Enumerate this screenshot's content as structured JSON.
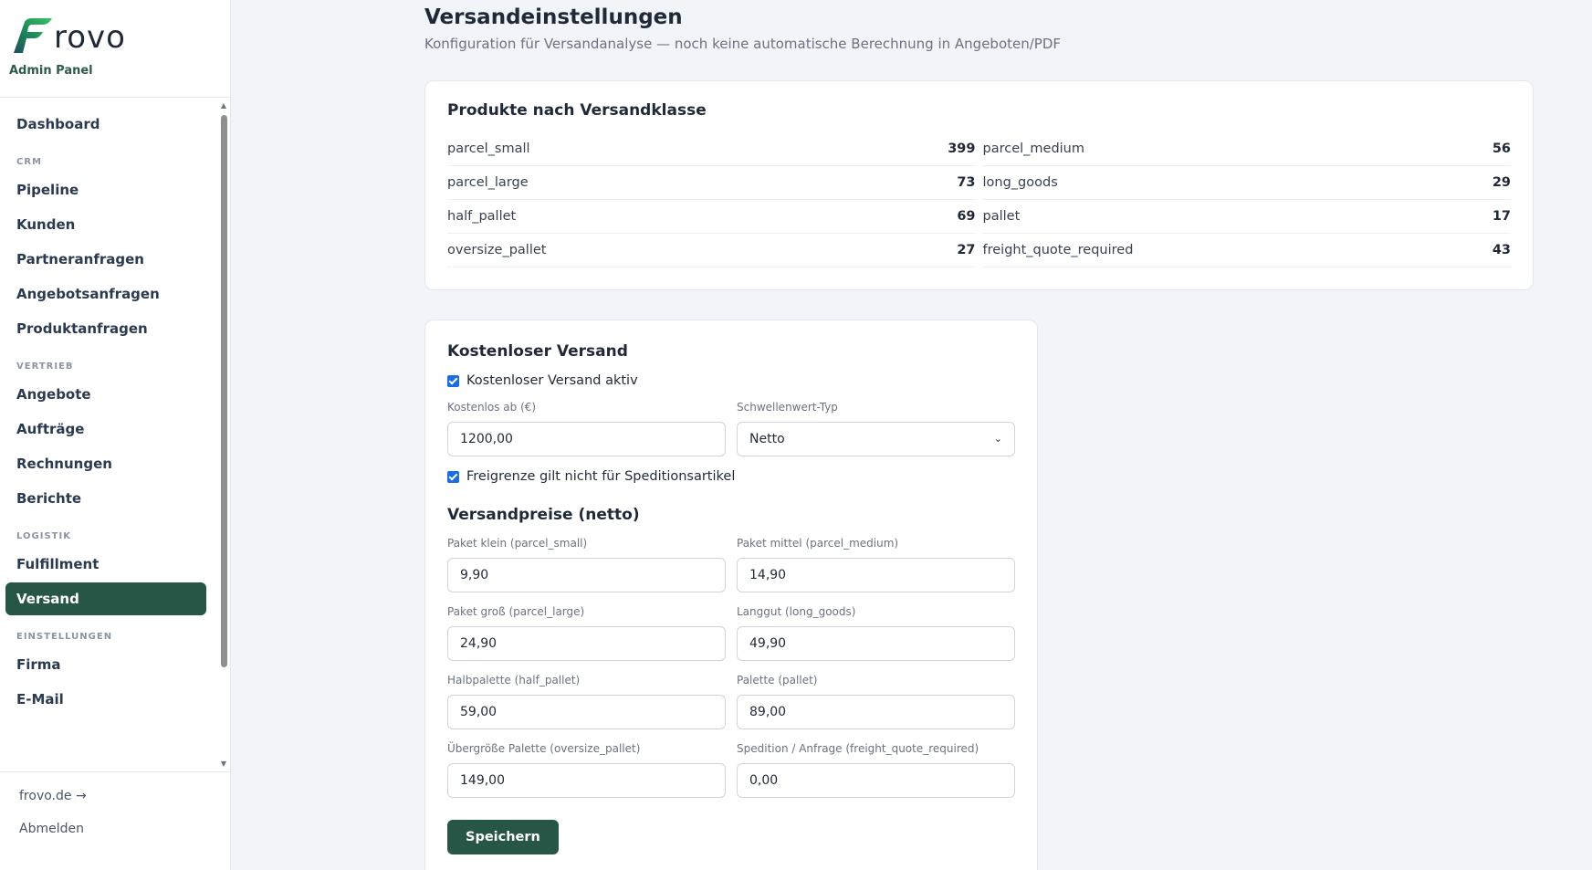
{
  "brand": {
    "name": "rovo",
    "subtitle": "Admin Panel",
    "accent": "#275646"
  },
  "nav": {
    "dashboard": "Dashboard",
    "sections": [
      {
        "title": "CRM",
        "items": [
          "Pipeline",
          "Kunden",
          "Partneranfragen",
          "Angebotsanfragen",
          "Produktanfragen"
        ]
      },
      {
        "title": "VERTRIEB",
        "items": [
          "Angebote",
          "Aufträge",
          "Rechnungen",
          "Berichte"
        ]
      },
      {
        "title": "LOGISTIK",
        "items": [
          "Fulfillment",
          "Versand"
        ]
      },
      {
        "title": "EINSTELLUNGEN",
        "items": [
          "Firma",
          "E-Mail"
        ]
      }
    ],
    "active": "Versand"
  },
  "footer": {
    "site_link": "frovo.de →",
    "logout": "Abmelden"
  },
  "page": {
    "title": "Versandeinstellungen",
    "subtitle": "Konfiguration für Versandanalyse — noch keine automatische Berechnung in Angeboten/PDF"
  },
  "classes_card": {
    "title": "Produkte nach Versandklasse",
    "left": [
      {
        "name": "parcel_small",
        "count": "399"
      },
      {
        "name": "parcel_large",
        "count": "73"
      },
      {
        "name": "half_pallet",
        "count": "69"
      },
      {
        "name": "oversize_pallet",
        "count": "27"
      }
    ],
    "right": [
      {
        "name": "parcel_medium",
        "count": "56"
      },
      {
        "name": "long_goods",
        "count": "29"
      },
      {
        "name": "pallet",
        "count": "17"
      },
      {
        "name": "freight_quote_required",
        "count": "43"
      }
    ]
  },
  "free_shipping": {
    "title": "Kostenloser Versand",
    "active_label": "Kostenloser Versand aktiv",
    "active_checked": true,
    "threshold_label": "Kostenlos ab (€)",
    "threshold_value": "1200,00",
    "type_label": "Schwellenwert-Typ",
    "type_value": "Netto",
    "exclude_label": "Freigrenze gilt nicht für Speditionsartikel",
    "exclude_checked": true
  },
  "prices": {
    "title": "Versandpreise (netto)",
    "fields": [
      {
        "label": "Paket klein (parcel_small)",
        "value": "9,90"
      },
      {
        "label": "Paket mittel (parcel_medium)",
        "value": "14,90"
      },
      {
        "label": "Paket groß (parcel_large)",
        "value": "24,90"
      },
      {
        "label": "Langgut (long_goods)",
        "value": "49,90"
      },
      {
        "label": "Halbpalette (half_pallet)",
        "value": "59,00"
      },
      {
        "label": "Palette (pallet)",
        "value": "89,00"
      },
      {
        "label": "Übergröße Palette (oversize_pallet)",
        "value": "149,00"
      },
      {
        "label": "Spedition / Anfrage (freight_quote_required)",
        "value": "0,00"
      }
    ]
  },
  "save_label": "Speichern"
}
